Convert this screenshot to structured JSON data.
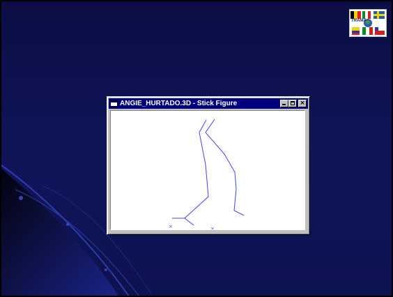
{
  "slide": {
    "background_color": "#10155a",
    "border_color": "#000000"
  },
  "logo": {
    "text": "TRAMA",
    "icon": "flags-globe-logo"
  },
  "window": {
    "title": "ANGIE_HURTADO.3D - Stick Figure",
    "titlebar_color": "#00007f",
    "controls": {
      "minimize": "minimize",
      "maximize": "maximize",
      "close": "×"
    },
    "canvas": {
      "background": "#ffffff",
      "line_color": "#4040ff",
      "marker_glyph": "×"
    }
  }
}
